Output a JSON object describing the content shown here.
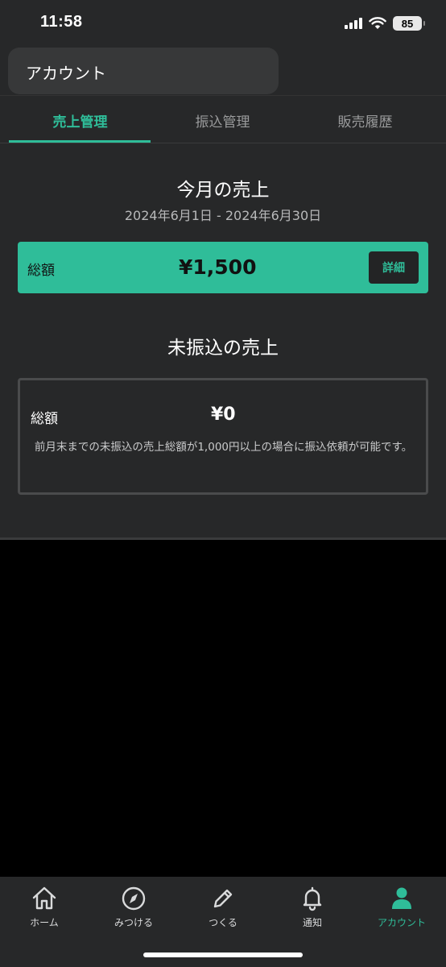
{
  "status_bar": {
    "time": "11:58",
    "battery": "85"
  },
  "header": {
    "title": "アカウント"
  },
  "tabs": [
    {
      "label": "売上管理",
      "active": true
    },
    {
      "label": "振込管理",
      "active": false
    },
    {
      "label": "販売履歴",
      "active": false
    }
  ],
  "monthly_sales": {
    "title": "今月の売上",
    "period": "2024年6月1日 - 2024年6月30日",
    "total_label": "総額",
    "total_amount": "¥1,500",
    "detail_button": "詳細"
  },
  "unpaid_sales": {
    "title": "未振込の売上",
    "total_label": "総額",
    "total_amount": "¥0",
    "note": "前月末までの未振込の売上総額が1,000円以上の場合に振込依頼が可能です。"
  },
  "bottom_nav": [
    {
      "label": "ホーム",
      "icon": "home-icon"
    },
    {
      "label": "みつける",
      "icon": "compass-icon"
    },
    {
      "label": "つくる",
      "icon": "pencil-icon"
    },
    {
      "label": "通知",
      "icon": "bell-icon"
    },
    {
      "label": "アカウント",
      "icon": "person-icon",
      "active": true
    }
  ],
  "colors": {
    "accent": "#2fbd99",
    "surface": "#272829",
    "background": "#000000"
  }
}
